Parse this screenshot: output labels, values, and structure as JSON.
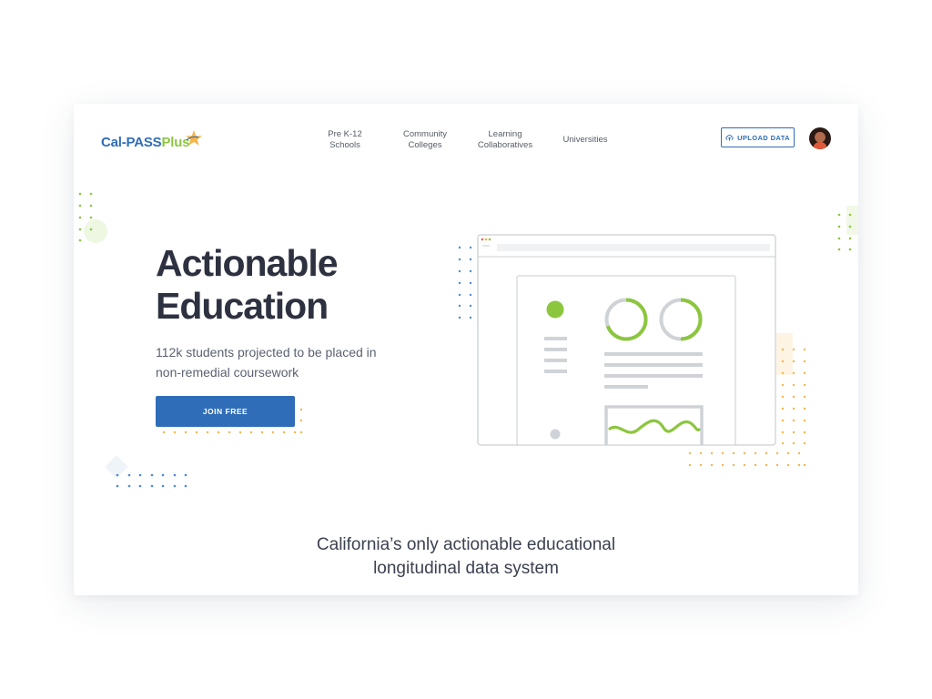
{
  "header": {
    "logo": {
      "part1": "Cal-PASS",
      "part2": "Plus"
    },
    "nav": [
      {
        "line1": "Pre K-12",
        "line2": "Schools"
      },
      {
        "line1": "Community",
        "line2": "Colleges"
      },
      {
        "line1": "Learning",
        "line2": "Collaboratives"
      },
      {
        "line1": "Universities",
        "line2": ""
      }
    ],
    "upload_label": "UPLOAD DATA"
  },
  "hero": {
    "title_line1": "Actionable",
    "title_line2": "Education",
    "subtitle_line1": "112k students projected to be placed in",
    "subtitle_line2": "non-remedial coursework",
    "cta_label": "JOIN FREE"
  },
  "tagline": {
    "line1": "California’s only actionable educational",
    "line2": "longitudinal data system"
  },
  "colors": {
    "brand_blue": "#2f6db8",
    "brand_green": "#8cc63f",
    "accent_orange": "#f5b54a",
    "heading": "#2e3140"
  }
}
